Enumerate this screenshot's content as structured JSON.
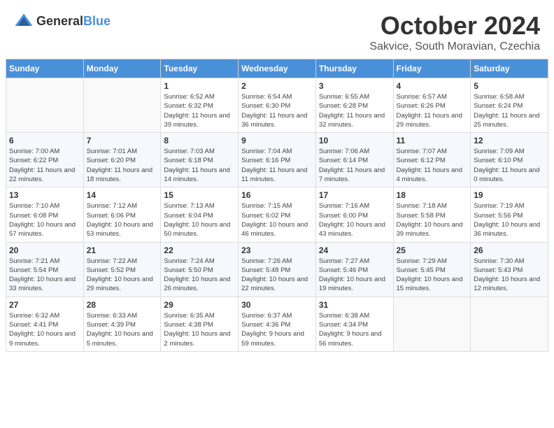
{
  "header": {
    "logo": {
      "general": "General",
      "blue": "Blue"
    },
    "title": "October 2024",
    "location": "Sakvice, South Moravian, Czechia"
  },
  "calendar": {
    "days_of_week": [
      "Sunday",
      "Monday",
      "Tuesday",
      "Wednesday",
      "Thursday",
      "Friday",
      "Saturday"
    ],
    "weeks": [
      {
        "days": [
          {
            "number": "",
            "info": ""
          },
          {
            "number": "",
            "info": ""
          },
          {
            "number": "1",
            "info": "Sunrise: 6:52 AM\nSunset: 6:32 PM\nDaylight: 11 hours and 39 minutes."
          },
          {
            "number": "2",
            "info": "Sunrise: 6:54 AM\nSunset: 6:30 PM\nDaylight: 11 hours and 36 minutes."
          },
          {
            "number": "3",
            "info": "Sunrise: 6:55 AM\nSunset: 6:28 PM\nDaylight: 11 hours and 32 minutes."
          },
          {
            "number": "4",
            "info": "Sunrise: 6:57 AM\nSunset: 6:26 PM\nDaylight: 11 hours and 29 minutes."
          },
          {
            "number": "5",
            "info": "Sunrise: 6:58 AM\nSunset: 6:24 PM\nDaylight: 11 hours and 25 minutes."
          }
        ]
      },
      {
        "days": [
          {
            "number": "6",
            "info": "Sunrise: 7:00 AM\nSunset: 6:22 PM\nDaylight: 11 hours and 22 minutes."
          },
          {
            "number": "7",
            "info": "Sunrise: 7:01 AM\nSunset: 6:20 PM\nDaylight: 11 hours and 18 minutes."
          },
          {
            "number": "8",
            "info": "Sunrise: 7:03 AM\nSunset: 6:18 PM\nDaylight: 11 hours and 14 minutes."
          },
          {
            "number": "9",
            "info": "Sunrise: 7:04 AM\nSunset: 6:16 PM\nDaylight: 11 hours and 11 minutes."
          },
          {
            "number": "10",
            "info": "Sunrise: 7:06 AM\nSunset: 6:14 PM\nDaylight: 11 hours and 7 minutes."
          },
          {
            "number": "11",
            "info": "Sunrise: 7:07 AM\nSunset: 6:12 PM\nDaylight: 11 hours and 4 minutes."
          },
          {
            "number": "12",
            "info": "Sunrise: 7:09 AM\nSunset: 6:10 PM\nDaylight: 11 hours and 0 minutes."
          }
        ]
      },
      {
        "days": [
          {
            "number": "13",
            "info": "Sunrise: 7:10 AM\nSunset: 6:08 PM\nDaylight: 10 hours and 57 minutes."
          },
          {
            "number": "14",
            "info": "Sunrise: 7:12 AM\nSunset: 6:06 PM\nDaylight: 10 hours and 53 minutes."
          },
          {
            "number": "15",
            "info": "Sunrise: 7:13 AM\nSunset: 6:04 PM\nDaylight: 10 hours and 50 minutes."
          },
          {
            "number": "16",
            "info": "Sunrise: 7:15 AM\nSunset: 6:02 PM\nDaylight: 10 hours and 46 minutes."
          },
          {
            "number": "17",
            "info": "Sunrise: 7:16 AM\nSunset: 6:00 PM\nDaylight: 10 hours and 43 minutes."
          },
          {
            "number": "18",
            "info": "Sunrise: 7:18 AM\nSunset: 5:58 PM\nDaylight: 10 hours and 39 minutes."
          },
          {
            "number": "19",
            "info": "Sunrise: 7:19 AM\nSunset: 5:56 PM\nDaylight: 10 hours and 36 minutes."
          }
        ]
      },
      {
        "days": [
          {
            "number": "20",
            "info": "Sunrise: 7:21 AM\nSunset: 5:54 PM\nDaylight: 10 hours and 33 minutes."
          },
          {
            "number": "21",
            "info": "Sunrise: 7:22 AM\nSunset: 5:52 PM\nDaylight: 10 hours and 29 minutes."
          },
          {
            "number": "22",
            "info": "Sunrise: 7:24 AM\nSunset: 5:50 PM\nDaylight: 10 hours and 26 minutes."
          },
          {
            "number": "23",
            "info": "Sunrise: 7:26 AM\nSunset: 5:48 PM\nDaylight: 10 hours and 22 minutes."
          },
          {
            "number": "24",
            "info": "Sunrise: 7:27 AM\nSunset: 5:46 PM\nDaylight: 10 hours and 19 minutes."
          },
          {
            "number": "25",
            "info": "Sunrise: 7:29 AM\nSunset: 5:45 PM\nDaylight: 10 hours and 15 minutes."
          },
          {
            "number": "26",
            "info": "Sunrise: 7:30 AM\nSunset: 5:43 PM\nDaylight: 10 hours and 12 minutes."
          }
        ]
      },
      {
        "days": [
          {
            "number": "27",
            "info": "Sunrise: 6:32 AM\nSunset: 4:41 PM\nDaylight: 10 hours and 9 minutes."
          },
          {
            "number": "28",
            "info": "Sunrise: 6:33 AM\nSunset: 4:39 PM\nDaylight: 10 hours and 5 minutes."
          },
          {
            "number": "29",
            "info": "Sunrise: 6:35 AM\nSunset: 4:38 PM\nDaylight: 10 hours and 2 minutes."
          },
          {
            "number": "30",
            "info": "Sunrise: 6:37 AM\nSunset: 4:36 PM\nDaylight: 9 hours and 59 minutes."
          },
          {
            "number": "31",
            "info": "Sunrise: 6:38 AM\nSunset: 4:34 PM\nDaylight: 9 hours and 56 minutes."
          },
          {
            "number": "",
            "info": ""
          },
          {
            "number": "",
            "info": ""
          }
        ]
      }
    ]
  }
}
